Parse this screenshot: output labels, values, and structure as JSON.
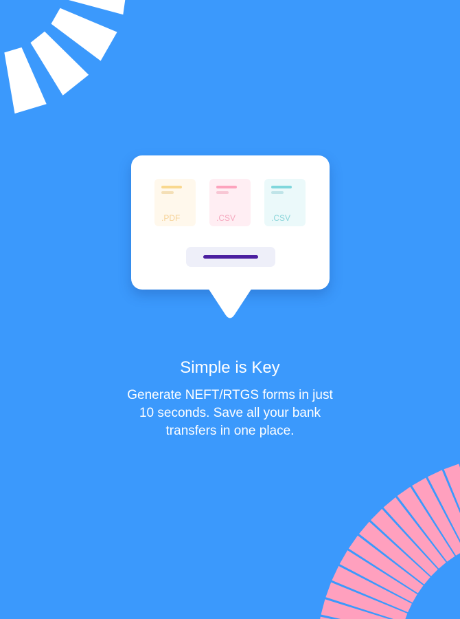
{
  "colors": {
    "background": "#3b99fc",
    "card": "#ffffff",
    "decor_top_left": "#ffffff",
    "decor_bottom_right": "#ffa0be",
    "action_bar": "#4b1fa0",
    "action_pill": "#eeeff9"
  },
  "illustration": {
    "files": [
      {
        "ext": ".PDF",
        "tile_color": "#fff8ec",
        "line1_color": "#f9d88e",
        "line2_color": "#f4dfb6",
        "text_color": "#f6d296"
      },
      {
        "ext": ".CSV",
        "tile_color": "#ffeef3",
        "line1_color": "#fda3bd",
        "line2_color": "#f8c6d4",
        "text_color": "#f5a8be"
      },
      {
        "ext": ".CSV",
        "tile_color": "#ebf9fa",
        "line1_color": "#7fd7dc",
        "line2_color": "#bfe4e8",
        "text_color": "#8ad5d9"
      }
    ]
  },
  "onboarding": {
    "title": "Simple is Key",
    "description": "Generate NEFT/RTGS forms in just 10 seconds. Save all your bank transfers in one place."
  }
}
